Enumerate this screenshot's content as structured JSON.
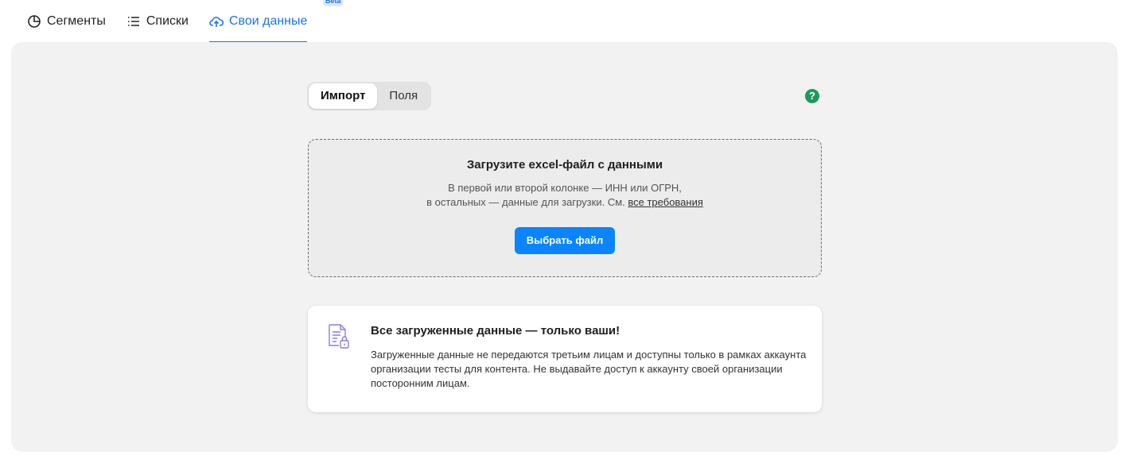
{
  "tabs": [
    {
      "label": "Сегменты",
      "icon": "pie-chart-icon"
    },
    {
      "label": "Списки",
      "icon": "list-icon"
    },
    {
      "label": "Свои данные",
      "icon": "cloud-upload-icon",
      "badge": "Beta",
      "active": true
    }
  ],
  "segmented": {
    "import_label": "Импорт",
    "fields_label": "Поля",
    "active": "Импорт"
  },
  "help": {
    "label": "?"
  },
  "dropzone": {
    "title": "Загрузите excel-файл с данными",
    "line1": "В первой или второй колонке — ИНН или ОГРН,",
    "line2_prefix": "в остальных — данные для загрузки. См. ",
    "line2_link": "все требования",
    "button_label": "Выбрать файл"
  },
  "info_card": {
    "icon": "document-lock-icon",
    "title": "Все загруженные данные — только ваши!",
    "text": "Загруженные данные не передаются третьим лицам и доступны только в рамках аккаунта организации тесты для контента. Не выдавайте доступ к аккаунту своей организации посторонним лицам."
  },
  "colors": {
    "accent": "#1a73e8",
    "button": "#0a84ff",
    "help": "#1c9a5b",
    "panel": "#f2f2f2"
  }
}
